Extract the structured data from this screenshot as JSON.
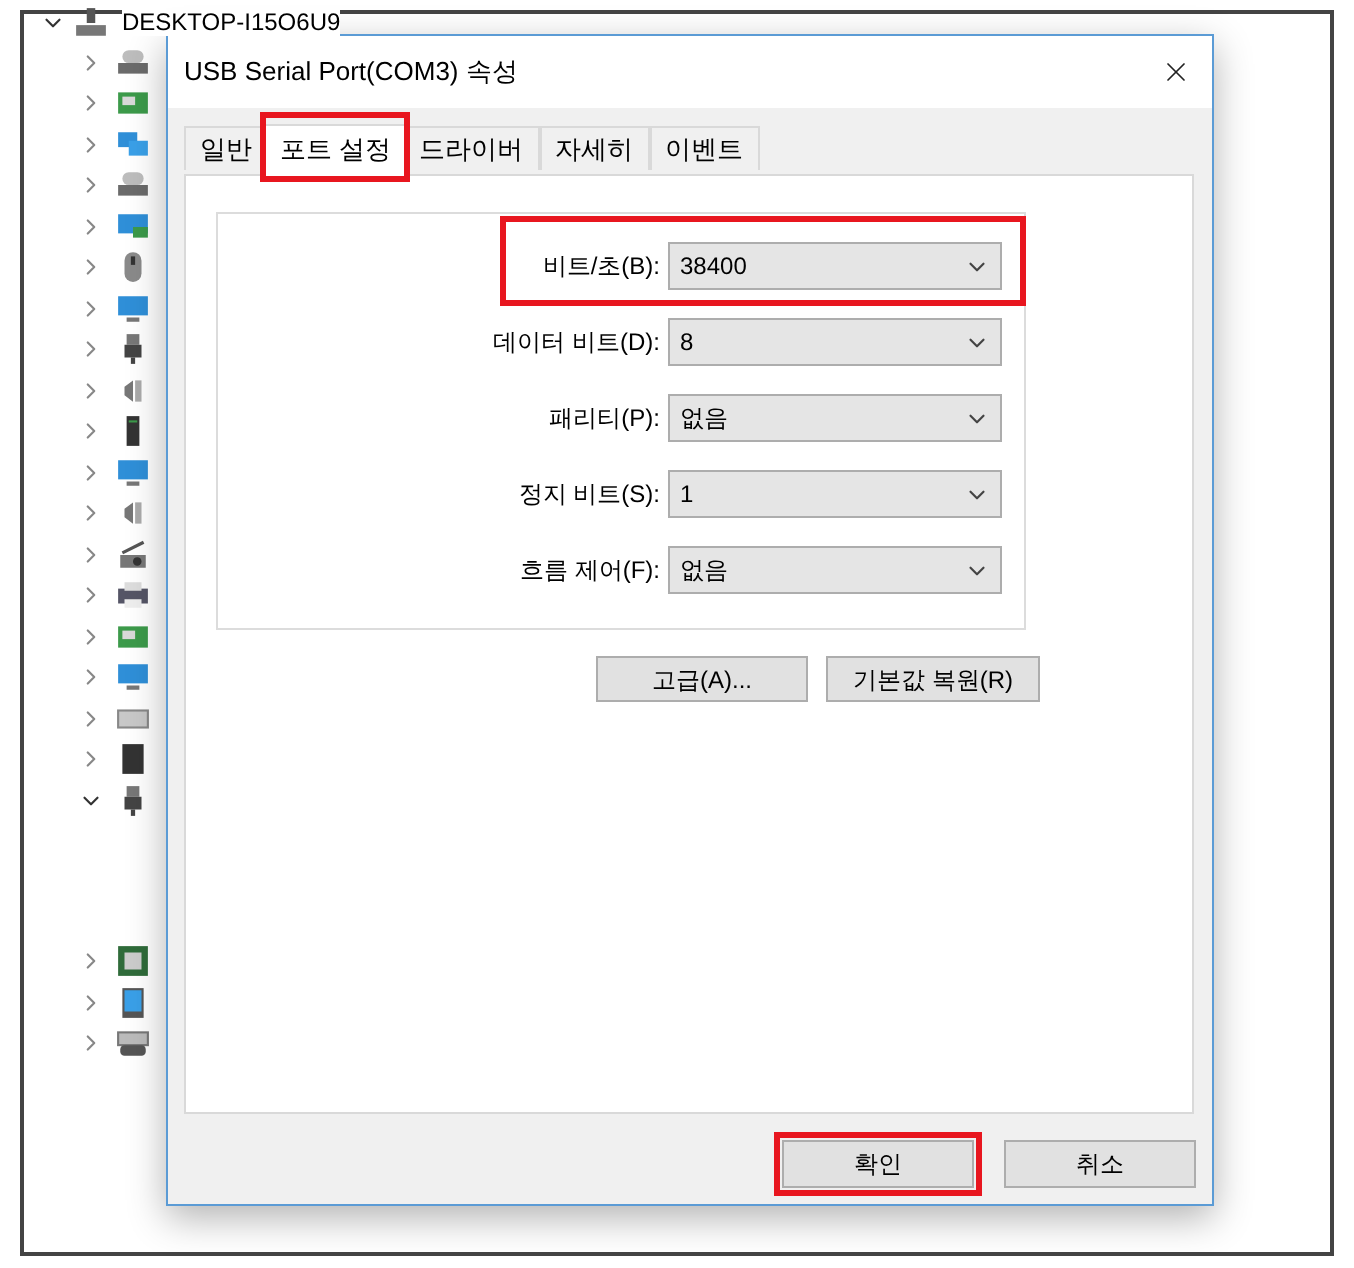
{
  "device_tree": {
    "root": {
      "label": "DESKTOP-I15O6U9",
      "expanded": true
    },
    "items": [
      {
        "expanded": false
      },
      {
        "expanded": false
      },
      {
        "expanded": false
      },
      {
        "expanded": false
      },
      {
        "expanded": false
      },
      {
        "expanded": false
      },
      {
        "expanded": false
      },
      {
        "expanded": false
      },
      {
        "expanded": false
      },
      {
        "expanded": false
      },
      {
        "expanded": false
      },
      {
        "expanded": false
      },
      {
        "expanded": false
      },
      {
        "expanded": false
      },
      {
        "expanded": false
      },
      {
        "expanded": false
      },
      {
        "expanded": false
      },
      {
        "expanded": false
      },
      {
        "expanded": true
      },
      {
        "expanded": false
      },
      {
        "expanded": false
      },
      {
        "expanded": false
      }
    ]
  },
  "dialog": {
    "title": "USB Serial Port(COM3) 속성",
    "tabs": [
      {
        "label": "일반",
        "selected": false,
        "highlighted": false
      },
      {
        "label": "포트 설정",
        "selected": true,
        "highlighted": true
      },
      {
        "label": "드라이버",
        "selected": false,
        "highlighted": false
      },
      {
        "label": "자세히",
        "selected": false,
        "highlighted": false
      },
      {
        "label": "이벤트",
        "selected": false,
        "highlighted": false
      }
    ],
    "settings": [
      {
        "label": "비트/초(B):",
        "value": "38400",
        "highlighted": true
      },
      {
        "label": "데이터 비트(D):",
        "value": "8",
        "highlighted": false
      },
      {
        "label": "패리티(P):",
        "value": "없음",
        "highlighted": false
      },
      {
        "label": "정지 비트(S):",
        "value": "1",
        "highlighted": false
      },
      {
        "label": "흐름 제어(F):",
        "value": "없음",
        "highlighted": false
      }
    ],
    "buttons": [
      "고급(A)...",
      "기본값 복원(R)"
    ],
    "footer_buttons": [
      {
        "label": "확인",
        "highlighted": true
      },
      {
        "label": "취소",
        "highlighted": false
      }
    ]
  }
}
